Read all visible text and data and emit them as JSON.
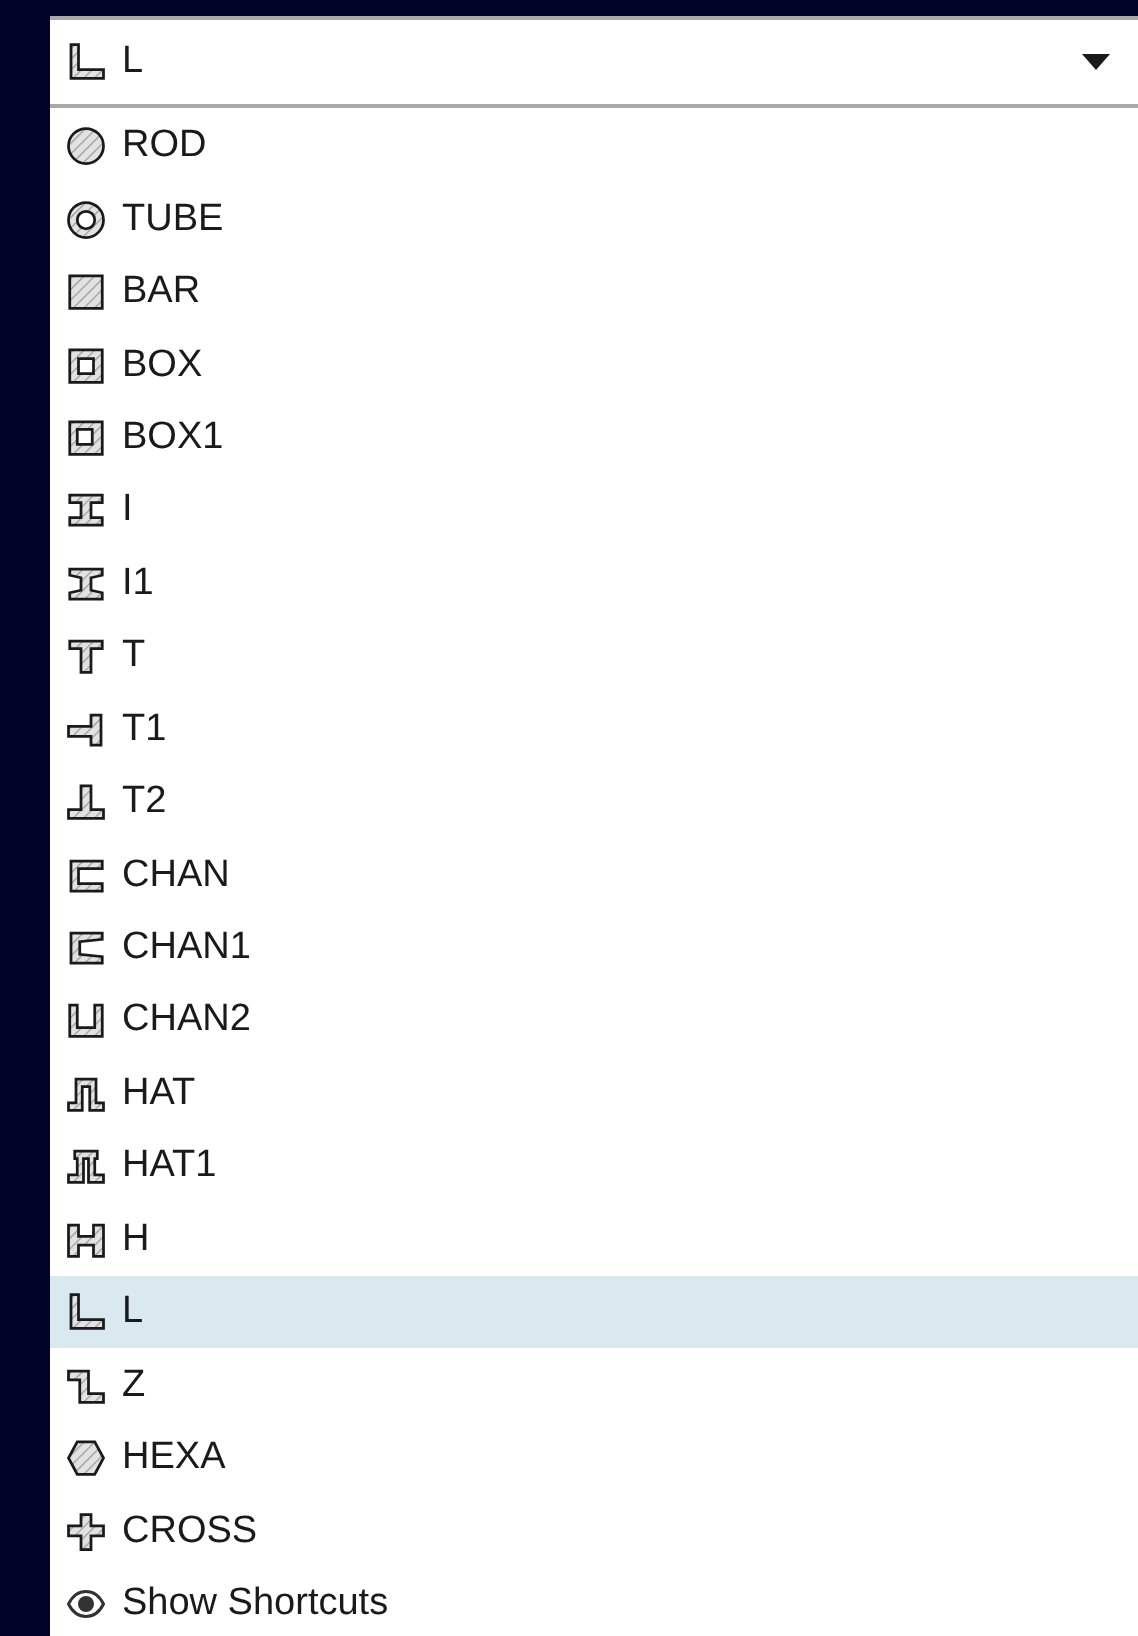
{
  "dropdown": {
    "value": "L"
  },
  "options": [
    {
      "label": "ROD",
      "selected": false
    },
    {
      "label": "TUBE",
      "selected": false
    },
    {
      "label": "BAR",
      "selected": false
    },
    {
      "label": "BOX",
      "selected": false
    },
    {
      "label": "BOX1",
      "selected": false
    },
    {
      "label": "I",
      "selected": false
    },
    {
      "label": "I1",
      "selected": false
    },
    {
      "label": "T",
      "selected": false
    },
    {
      "label": "T1",
      "selected": false
    },
    {
      "label": "T2",
      "selected": false
    },
    {
      "label": "CHAN",
      "selected": false
    },
    {
      "label": "CHAN1",
      "selected": false
    },
    {
      "label": "CHAN2",
      "selected": false
    },
    {
      "label": "HAT",
      "selected": false
    },
    {
      "label": "HAT1",
      "selected": false
    },
    {
      "label": "H",
      "selected": false
    },
    {
      "label": "L",
      "selected": true
    },
    {
      "label": "Z",
      "selected": false
    },
    {
      "label": "HEXA",
      "selected": false
    },
    {
      "label": "CROSS",
      "selected": false
    }
  ],
  "footer_option": {
    "label": "Show Shortcuts"
  }
}
